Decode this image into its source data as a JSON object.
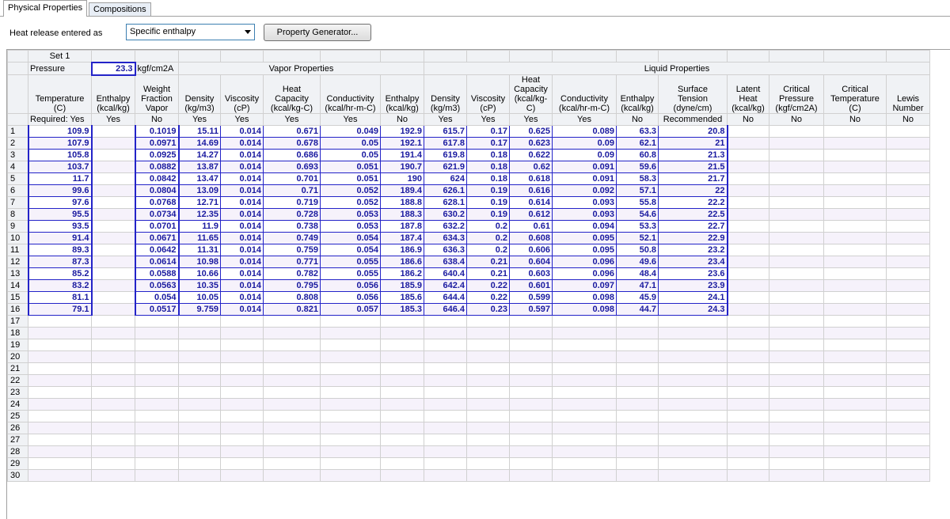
{
  "tabs": [
    {
      "label": "Physical Properties"
    },
    {
      "label": "Compositions"
    }
  ],
  "toolbar": {
    "heat_release_label": "Heat release entered as",
    "heat_release_value": "Specific enthalpy",
    "property_generator_label": "Property Generator..."
  },
  "grid": {
    "set_label": "Set 1",
    "pressure_label": "Pressure",
    "pressure_value": "23.3",
    "pressure_unit": "kgf/cm2A",
    "vapor_group": "Vapor Properties",
    "liquid_group": "Liquid Properties",
    "columns": [
      {
        "l1": "",
        "l2": "",
        "l3": "Temperature",
        "l4": "(C)",
        "req": "Required: Yes"
      },
      {
        "l1": "",
        "l2": "",
        "l3": "Enthalpy",
        "l4": "(kcal/kg)",
        "req": "Yes"
      },
      {
        "l1": "",
        "l2": "Weight",
        "l3": "Fraction",
        "l4": "Vapor",
        "req": "No"
      },
      {
        "l1": "",
        "l2": "",
        "l3": "Density",
        "l4": "(kg/m3)",
        "req": "Yes"
      },
      {
        "l1": "",
        "l2": "",
        "l3": "Viscosity",
        "l4": "(cP)",
        "req": "Yes"
      },
      {
        "l1": "",
        "l2": "Heat",
        "l3": "Capacity",
        "l4": "(kcal/kg-C)",
        "req": "Yes"
      },
      {
        "l1": "",
        "l2": "",
        "l3": "Conductivity",
        "l4": "(kcal/hr-m-C)",
        "req": "Yes"
      },
      {
        "l1": "",
        "l2": "",
        "l3": "Enthalpy",
        "l4": "(kcal/kg)",
        "req": "No"
      },
      {
        "l1": "",
        "l2": "",
        "l3": "Density",
        "l4": "(kg/m3)",
        "req": "Yes"
      },
      {
        "l1": "",
        "l2": "",
        "l3": "Viscosity",
        "l4": "(cP)",
        "req": "Yes"
      },
      {
        "l1": "",
        "l2": "Heat",
        "l3": "Capacity",
        "l4": "(kcal/kg-C)",
        "req": "Yes"
      },
      {
        "l1": "",
        "l2": "",
        "l3": "Conductivity",
        "l4": "(kcal/hr-m-C)",
        "req": "Yes"
      },
      {
        "l1": "",
        "l2": "",
        "l3": "Enthalpy",
        "l4": "(kcal/kg)",
        "req": "No"
      },
      {
        "l1": "",
        "l2": "Surface",
        "l3": "Tension",
        "l4": "(dyne/cm)",
        "req": "Recommended"
      },
      {
        "l1": "",
        "l2": "Latent",
        "l3": "Heat",
        "l4": "(kcal/kg)",
        "req": "No"
      },
      {
        "l1": "",
        "l2": "Critical",
        "l3": "Pressure",
        "l4": "(kgf/cm2A)",
        "req": "No"
      },
      {
        "l1": "",
        "l2": "Critical",
        "l3": "Temperature",
        "l4": "(C)",
        "req": "No"
      },
      {
        "l1": "",
        "l2": "",
        "l3": "Lewis",
        "l4": "Number",
        "req": "No"
      }
    ],
    "rows": [
      [
        "109.9",
        "",
        "0.1019",
        "15.11",
        "0.014",
        "0.671",
        "0.049",
        "192.9",
        "615.7",
        "0.17",
        "0.625",
        "0.089",
        "63.3",
        "20.8",
        "",
        "",
        "",
        ""
      ],
      [
        "107.9",
        "",
        "0.0971",
        "14.69",
        "0.014",
        "0.678",
        "0.05",
        "192.1",
        "617.8",
        "0.17",
        "0.623",
        "0.09",
        "62.1",
        "21",
        "",
        "",
        "",
        ""
      ],
      [
        "105.8",
        "",
        "0.0925",
        "14.27",
        "0.014",
        "0.686",
        "0.05",
        "191.4",
        "619.8",
        "0.18",
        "0.622",
        "0.09",
        "60.8",
        "21.3",
        "",
        "",
        "",
        ""
      ],
      [
        "103.7",
        "",
        "0.0882",
        "13.87",
        "0.014",
        "0.693",
        "0.051",
        "190.7",
        "621.9",
        "0.18",
        "0.62",
        "0.091",
        "59.6",
        "21.5",
        "",
        "",
        "",
        ""
      ],
      [
        "11.7",
        "",
        "0.0842",
        "13.47",
        "0.014",
        "0.701",
        "0.051",
        "190",
        "624",
        "0.18",
        "0.618",
        "0.091",
        "58.3",
        "21.7",
        "",
        "",
        "",
        ""
      ],
      [
        "99.6",
        "",
        "0.0804",
        "13.09",
        "0.014",
        "0.71",
        "0.052",
        "189.4",
        "626.1",
        "0.19",
        "0.616",
        "0.092",
        "57.1",
        "22",
        "",
        "",
        "",
        ""
      ],
      [
        "97.6",
        "",
        "0.0768",
        "12.71",
        "0.014",
        "0.719",
        "0.052",
        "188.8",
        "628.1",
        "0.19",
        "0.614",
        "0.093",
        "55.8",
        "22.2",
        "",
        "",
        "",
        ""
      ],
      [
        "95.5",
        "",
        "0.0734",
        "12.35",
        "0.014",
        "0.728",
        "0.053",
        "188.3",
        "630.2",
        "0.19",
        "0.612",
        "0.093",
        "54.6",
        "22.5",
        "",
        "",
        "",
        ""
      ],
      [
        "93.5",
        "",
        "0.0701",
        "11.9",
        "0.014",
        "0.738",
        "0.053",
        "187.8",
        "632.2",
        "0.2",
        "0.61",
        "0.094",
        "53.3",
        "22.7",
        "",
        "",
        "",
        ""
      ],
      [
        "91.4",
        "",
        "0.0671",
        "11.65",
        "0.014",
        "0.749",
        "0.054",
        "187.4",
        "634.3",
        "0.2",
        "0.608",
        "0.095",
        "52.1",
        "22.9",
        "",
        "",
        "",
        ""
      ],
      [
        "89.3",
        "",
        "0.0642",
        "11.31",
        "0.014",
        "0.759",
        "0.054",
        "186.9",
        "636.3",
        "0.2",
        "0.606",
        "0.095",
        "50.8",
        "23.2",
        "",
        "",
        "",
        ""
      ],
      [
        "87.3",
        "",
        "0.0614",
        "10.98",
        "0.014",
        "0.771",
        "0.055",
        "186.6",
        "638.4",
        "0.21",
        "0.604",
        "0.096",
        "49.6",
        "23.4",
        "",
        "",
        "",
        ""
      ],
      [
        "85.2",
        "",
        "0.0588",
        "10.66",
        "0.014",
        "0.782",
        "0.055",
        "186.2",
        "640.4",
        "0.21",
        "0.603",
        "0.096",
        "48.4",
        "23.6",
        "",
        "",
        "",
        ""
      ],
      [
        "83.2",
        "",
        "0.0563",
        "10.35",
        "0.014",
        "0.795",
        "0.056",
        "185.9",
        "642.4",
        "0.22",
        "0.601",
        "0.097",
        "47.1",
        "23.9",
        "",
        "",
        "",
        ""
      ],
      [
        "81.1",
        "",
        "0.054",
        "10.05",
        "0.014",
        "0.808",
        "0.056",
        "185.6",
        "644.4",
        "0.22",
        "0.599",
        "0.098",
        "45.9",
        "24.1",
        "",
        "",
        "",
        ""
      ],
      [
        "79.1",
        "",
        "0.0517",
        "9.759",
        "0.014",
        "0.821",
        "0.057",
        "185.3",
        "646.4",
        "0.23",
        "0.597",
        "0.098",
        "44.7",
        "24.3",
        "",
        "",
        "",
        ""
      ]
    ],
    "row_numbers": [
      "1",
      "2",
      "3",
      "4",
      "5",
      "6",
      "7",
      "8",
      "9",
      "10",
      "11",
      "12",
      "13",
      "14",
      "15",
      "16",
      "17",
      "18",
      "19",
      "20",
      "21",
      "22",
      "23",
      "24",
      "25",
      "26",
      "27",
      "28",
      "29",
      "30"
    ]
  }
}
